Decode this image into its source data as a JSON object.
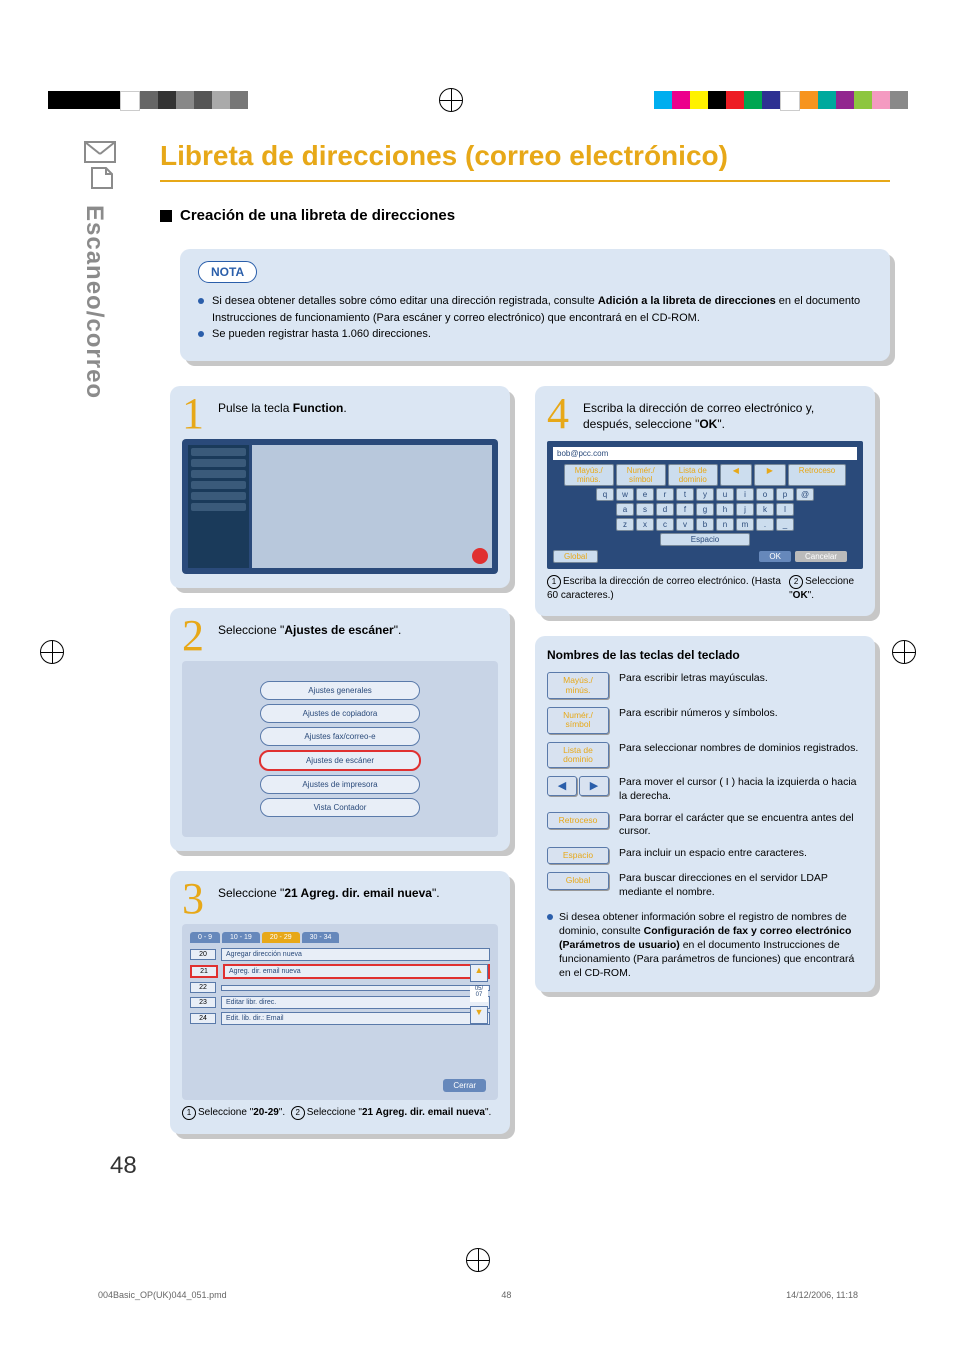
{
  "tab_label": "Escaneo/correo",
  "title": "Libreta de direcciones (correo electrónico)",
  "subtitle": "Creación de una libreta de direcciones",
  "note_label": "NOTA",
  "note_items": [
    "Si desea obtener detalles sobre cómo editar una dirección registrada, consulte <b>Adición a la libreta de direcciones</b> en el documento Instrucciones de funcionamiento (Para escáner y correo electrónico) que encontrará en el CD-ROM.",
    "Se pueden registrar hasta 1.060 direcciones."
  ],
  "step1": {
    "num": "1",
    "text": "Pulse la tecla <b>Function</b>."
  },
  "step2": {
    "num": "2",
    "text": "Seleccione \"<b>Ajustes de escáner</b>\".",
    "menu": [
      "Ajustes generales",
      "Ajustes de copiadora",
      "Ajustes fax/correo-e",
      "Ajustes de escáner",
      "Ajustes de impresora",
      "Vista Contador"
    ]
  },
  "step3": {
    "num": "3",
    "text": "Seleccione \"<b>21 Agreg. dir. email nueva</b>\".",
    "tabs": [
      "0 - 9",
      "10 - 19",
      "20 - 29",
      "30 - 34"
    ],
    "rows": [
      {
        "n": "20",
        "t": "Agregar dirección nueva"
      },
      {
        "n": "21",
        "t": "Agreg. dir. email nueva"
      },
      {
        "n": "22",
        "t": ""
      },
      {
        "n": "23",
        "t": "Editar libr. direc."
      },
      {
        "n": "24",
        "t": "Edit. lib. dir.: Email"
      }
    ],
    "close": "Cerrar",
    "caption_a": "Seleccione \"<b>20-29</b>\".",
    "caption_b": "Seleccione \"<b>21 Agreg. dir. email nueva</b>\"."
  },
  "step4": {
    "num": "4",
    "text": "Escriba la dirección de correo electrónico y, después, seleccione \"<b>OK</b>\".",
    "field": "bob@pcc.com",
    "top_keys": [
      "Mayús./\nminús.",
      "Numér./\nsímbol",
      "Lista de\ndominio",
      "◀",
      "▶",
      "Retroceso"
    ],
    "rows": [
      [
        "q",
        "w",
        "e",
        "r",
        "t",
        "y",
        "u",
        "i",
        "o",
        "p",
        "@"
      ],
      [
        "a",
        "s",
        "d",
        "f",
        "g",
        "h",
        "j",
        "k",
        "l"
      ],
      [
        "z",
        "x",
        "c",
        "v",
        "b",
        "n",
        "m",
        ".",
        "_"
      ]
    ],
    "space": "Espacio",
    "foot": [
      "Global",
      "OK",
      "Cancelar"
    ],
    "caption_a": "Escriba la dirección de correo electrónico. (Hasta 60 caracteres.)",
    "caption_b": "Seleccione \"<b>OK</b>\"."
  },
  "keyref": {
    "title": "Nombres de las teclas del teclado",
    "rows": [
      {
        "k": [
          "Mayús./\nminús."
        ],
        "t": "Para escribir letras mayúsculas."
      },
      {
        "k": [
          "Numér./\nsímbol"
        ],
        "t": "Para escribir números y símbolos."
      },
      {
        "k": [
          "Lista de\ndominio"
        ],
        "t": "Para seleccionar nombres de dominios registrados."
      },
      {
        "k": [
          "◀",
          "▶"
        ],
        "arrow": true,
        "t": "Para mover el cursor ( I ) hacia la izquierda o hacia la derecha."
      },
      {
        "k": [
          "Retroceso"
        ],
        "t": "Para borrar el carácter que se encuentra antes del cursor."
      },
      {
        "k": [
          "Espacio"
        ],
        "t": "Para incluir un espacio entre caracteres."
      },
      {
        "k": [
          "Global"
        ],
        "t": "Para buscar direcciones en el servidor LDAP mediante el nombre."
      }
    ],
    "foot": "Si desea obtener información sobre el registro de nombres de dominio, consulte <b>Configuración de fax y correo electrónico (Parámetros de usuario)</b> en el documento Instrucciones de funcionamiento (Para parámetros de funciones) que encontrará en el CD-ROM."
  },
  "page_num": "48",
  "footer": {
    "file": "004Basic_OP(UK)044_051.pmd",
    "p": "48",
    "date": "14/12/2006, 11:18"
  }
}
